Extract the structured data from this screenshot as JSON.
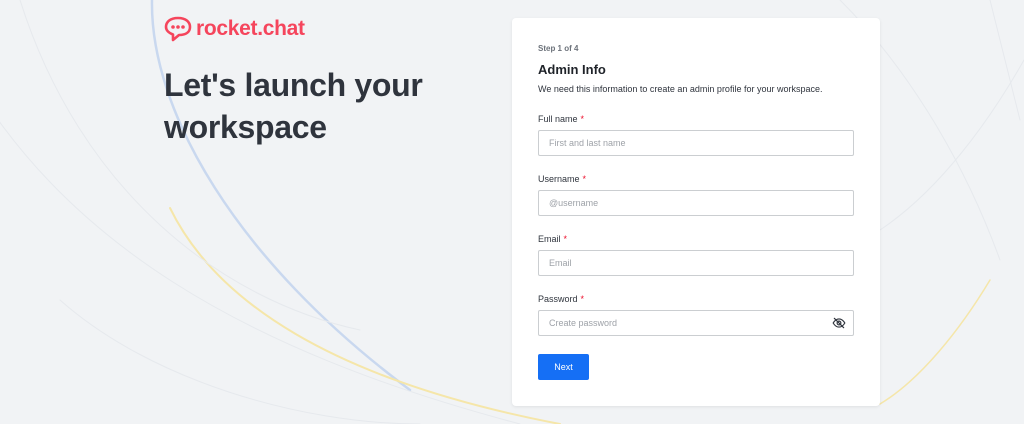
{
  "brand": {
    "logo_text": "rocket.chat",
    "logo_icon": "rocket-chat-bubble-icon",
    "color": "#f5455c"
  },
  "hero": {
    "headline": "Let's launch your workspace"
  },
  "form": {
    "step": "Step 1 of 4",
    "title": "Admin Info",
    "description": "We need this information to create an admin profile for your workspace.",
    "required_marker": "*",
    "fields": {
      "full_name": {
        "label": "Full name",
        "placeholder": "First and last name",
        "value": ""
      },
      "username": {
        "label": "Username",
        "placeholder": "@username",
        "value": ""
      },
      "email": {
        "label": "Email",
        "placeholder": "Email",
        "value": ""
      },
      "password": {
        "label": "Password",
        "placeholder": "Create password",
        "value": "",
        "toggle_icon": "eye-off-icon"
      }
    },
    "next_label": "Next"
  },
  "colors": {
    "primary": "#156ff5",
    "required": "#ec0d2a",
    "background": "#f1f3f5"
  }
}
